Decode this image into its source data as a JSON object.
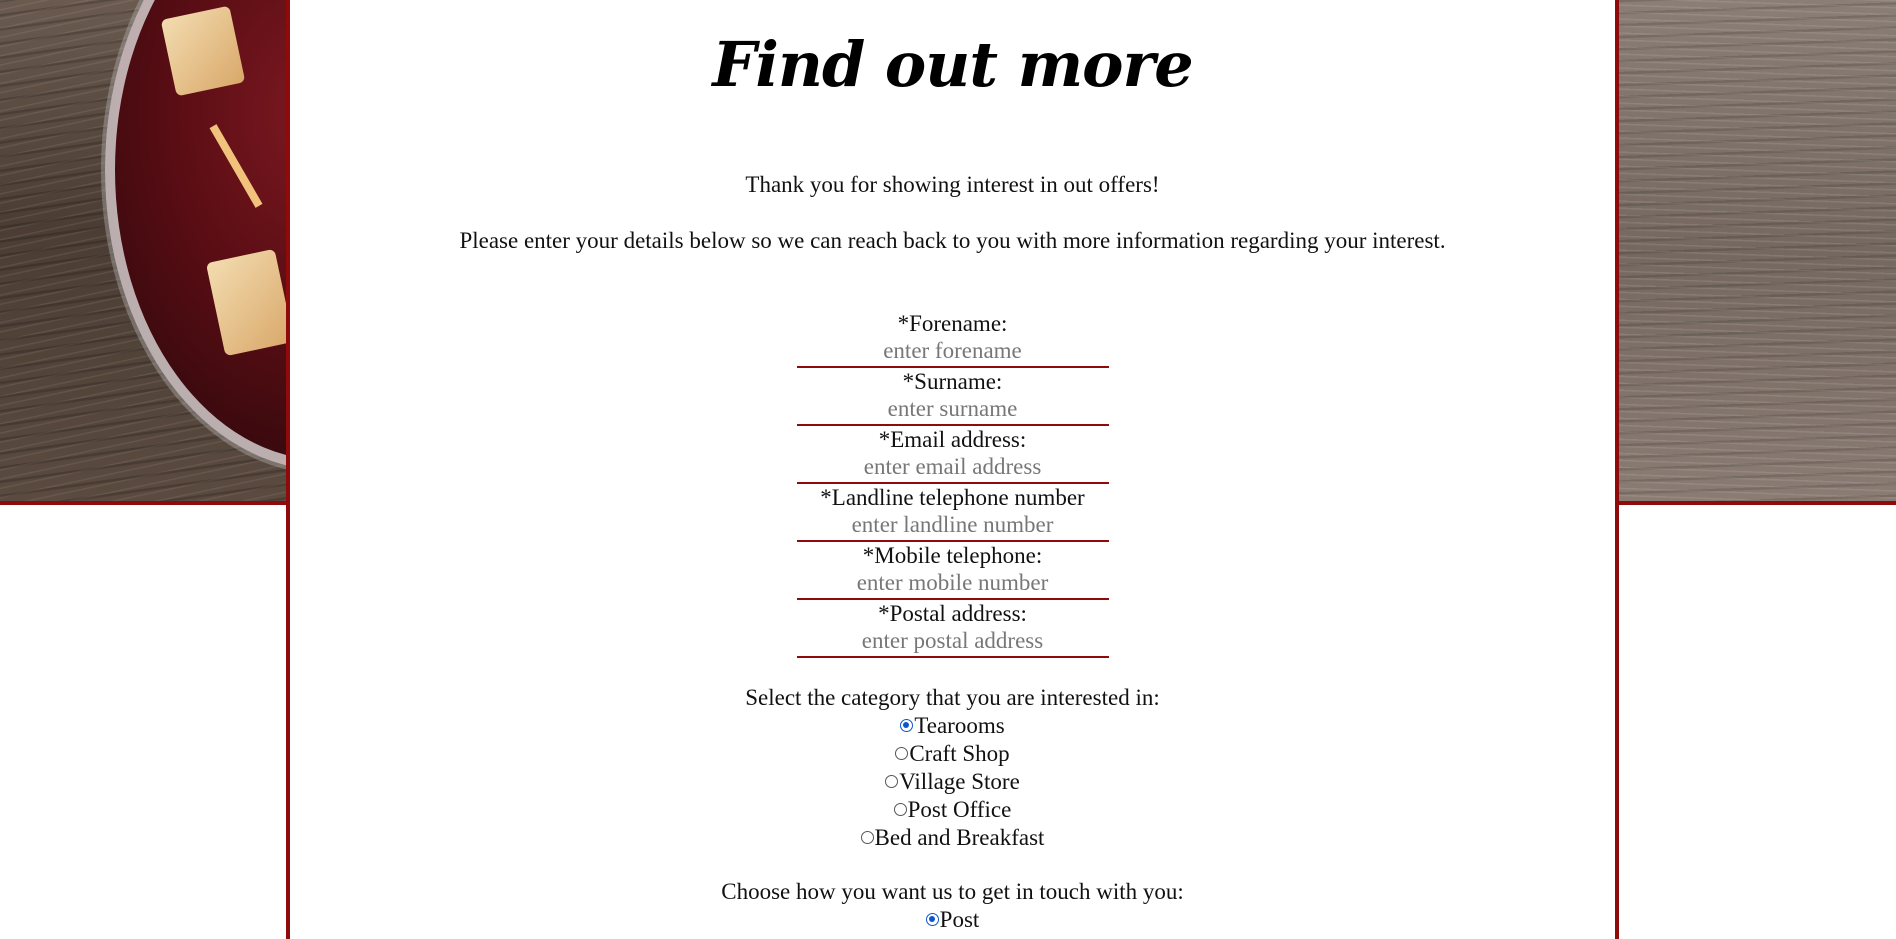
{
  "page": {
    "title": "Find out more",
    "intro_line_1": "Thank you for showing interest in out offers!",
    "intro_line_2": "Please enter your details below so we can reach back to you with more information regarding your interest."
  },
  "form": {
    "fields": [
      {
        "label": "*Forename:",
        "placeholder": "enter forename"
      },
      {
        "label": "*Surname:",
        "placeholder": "enter surname"
      },
      {
        "label": "*Email address:",
        "placeholder": "enter email address"
      },
      {
        "label": "*Landline telephone number",
        "placeholder": "enter landline number"
      },
      {
        "label": "*Mobile telephone:",
        "placeholder": "enter mobile number"
      },
      {
        "label": "*Postal address:",
        "placeholder": "enter postal address"
      }
    ],
    "category": {
      "label": "Select the category that you are interested in:",
      "options": [
        "Tearooms",
        "Craft Shop",
        "Village Store",
        "Post Office",
        "Bed and Breakfast"
      ],
      "selected": "Tearooms"
    },
    "contact": {
      "label": "Choose how you want us to get in touch with you:",
      "options": [
        "Post"
      ],
      "selected": "Post"
    }
  },
  "colors": {
    "accent_border": "#8f0a0a",
    "radio_checked": "#0b57d0"
  }
}
